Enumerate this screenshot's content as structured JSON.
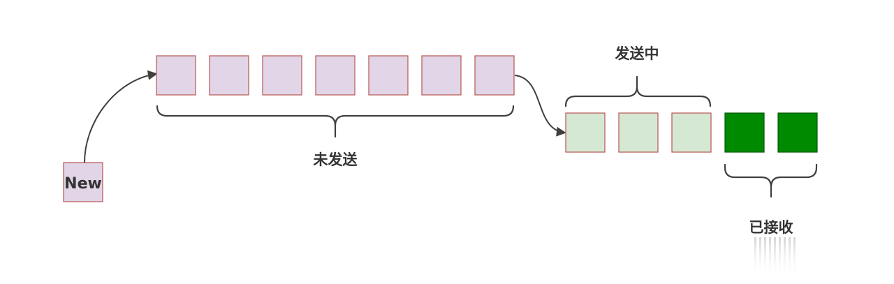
{
  "new_box": {
    "label": "New"
  },
  "unsent": {
    "label": "未发送",
    "count": 7
  },
  "sending": {
    "label": "发送中",
    "count": 3
  },
  "received": {
    "label": "已接收",
    "count": 2
  },
  "colors": {
    "unsent_fill": "#e1d5e7",
    "box_border": "#b85450",
    "sending_fill": "#d5e8d4",
    "received_fill": "#008a00",
    "received_border": "#005700",
    "line": "#3f3f3f",
    "text": "#333333"
  }
}
